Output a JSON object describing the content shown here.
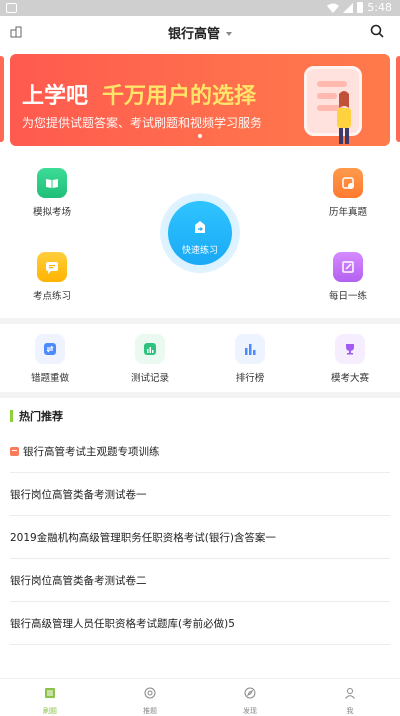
{
  "status_bar": {
    "time": "5:48"
  },
  "header": {
    "title": "银行高管"
  },
  "banner": {
    "headline_part1": "上学吧",
    "headline_part2": "千万用户的选择",
    "subtitle": "为您提供试题答案、考试刷题和视频学习服务"
  },
  "grid": {
    "mock_exam": "模拟考场",
    "past_papers": "历年真题",
    "quick_practice": "快速练习",
    "key_points": "考点练习",
    "daily": "每日一练"
  },
  "tools": {
    "redo_errors": "错题重做",
    "test_records": "测试记录",
    "ranking": "排行榜",
    "mock_contest": "模考大赛"
  },
  "hot": {
    "title": "热门推荐",
    "items": [
      "银行高管考试主观题专项训练",
      "银行岗位高管类备考测试卷一",
      "2019金融机构高级管理职务任职资格考试(银行)含答案一",
      "银行岗位高管类备考测试卷二",
      "银行高级管理人员任职资格考试题库(考前必做)5"
    ]
  },
  "tabbar": {
    "items": [
      {
        "label": "刷题",
        "icon": "list-icon"
      },
      {
        "label": "推题",
        "icon": "target-icon"
      },
      {
        "label": "发现",
        "icon": "compass-icon"
      },
      {
        "label": "我",
        "icon": "person-icon"
      }
    ],
    "active_color": "#8bc34a"
  },
  "colors": {
    "banner": "#ff5a4f",
    "accent_green": "#8bd13b",
    "quick_blue": "#1aa9f5"
  }
}
